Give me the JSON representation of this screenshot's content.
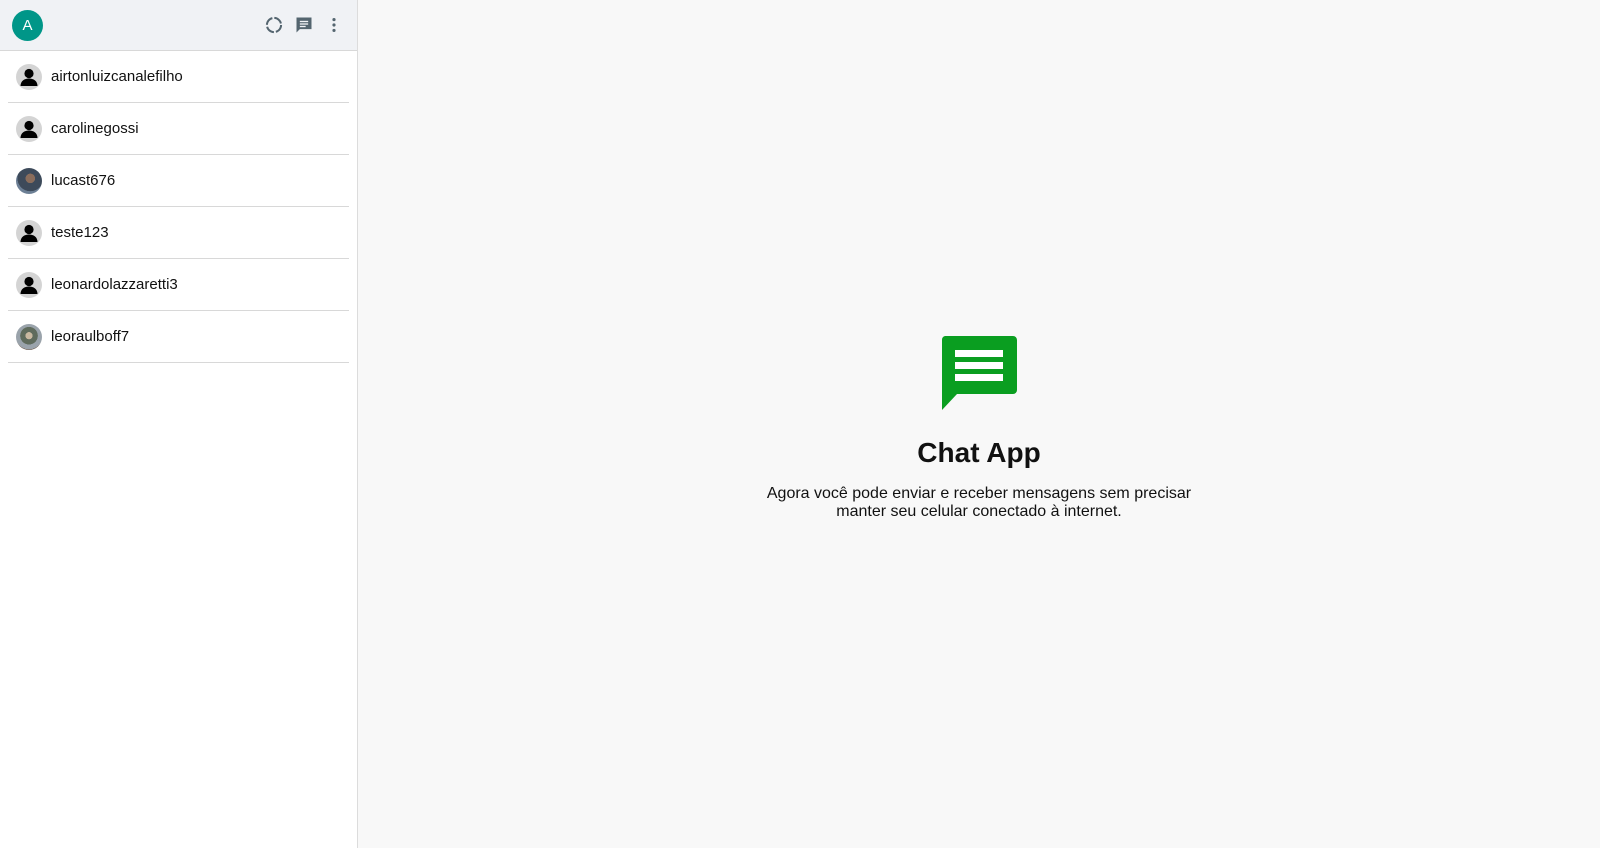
{
  "header": {
    "user_initial": "A",
    "avatar_color": "#009688",
    "icons": [
      "status-icon",
      "new-chat-icon",
      "more-options-icon"
    ]
  },
  "contacts": [
    {
      "name": "airtonluizcanalefilho",
      "avatar": "default-person-icon"
    },
    {
      "name": "carolinegossi",
      "avatar": "default-person-icon"
    },
    {
      "name": "lucast676",
      "avatar": "photo"
    },
    {
      "name": "teste123",
      "avatar": "default-person-icon"
    },
    {
      "name": "leonardolazzaretti3",
      "avatar": "default-person-icon"
    },
    {
      "name": "leoraulboff7",
      "avatar": "photo"
    }
  ],
  "welcome": {
    "icon": "chat-icon",
    "icon_color": "#0a9e20",
    "title": "Chat App",
    "text": "Agora você pode enviar e receber mensagens sem precisar manter seu celular conectado à internet."
  }
}
